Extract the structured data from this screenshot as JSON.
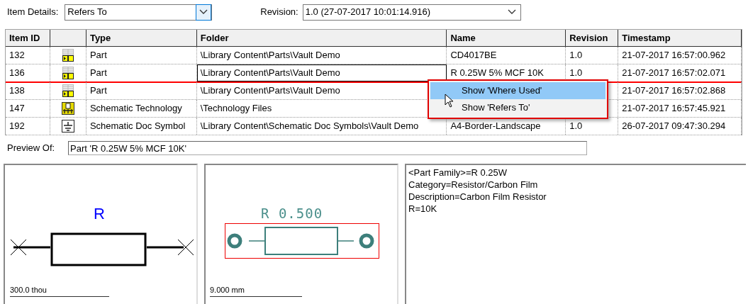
{
  "item_details": {
    "label": "Item Details:",
    "value": "Refers To"
  },
  "revision": {
    "label": "Revision:",
    "value": "1.0 (27-07-2017 10:01:14.916)"
  },
  "table": {
    "columns": [
      "Item ID",
      "Type",
      "Folder",
      "Name",
      "Revision",
      "Timestamp"
    ],
    "rows": [
      {
        "item_id": "132",
        "kind": "part",
        "type": "Part",
        "folder": "\\Library Content\\Parts\\Vault Demo",
        "name": "CD4017BE",
        "revision": "1.0",
        "timestamp": "21-07-2017 16:57:00.962",
        "focused": false
      },
      {
        "item_id": "136",
        "kind": "part",
        "type": "Part",
        "folder": "\\Library Content\\Parts\\Vault Demo",
        "name": "R 0.25W 5% MCF 10K",
        "revision": "1.0",
        "timestamp": "21-07-2017 16:57:02.071",
        "focused": true
      },
      {
        "item_id": "138",
        "kind": "part",
        "type": "Part",
        "folder": "\\Library Content\\Parts\\Vault Demo",
        "timestamp": "21-07-2017 16:57:02.868",
        "focused": false
      },
      {
        "item_id": "147",
        "kind": "technology",
        "type": "Schematic Technology",
        "folder": "\\Technology Files",
        "timestamp": "21-07-2017 16:57:45.921",
        "focused": false
      },
      {
        "item_id": "192",
        "kind": "symbol",
        "type": "Schematic Doc Symbol",
        "folder": "\\Library Content\\Schematic Doc Symbols\\Vault Demo",
        "name": "A4-Border-Landscape",
        "revision": "1.0",
        "timestamp": "26-07-2017 09:47:30.294",
        "focused": false
      }
    ]
  },
  "context_menu": {
    "items": [
      {
        "label": "Show 'Where Used'",
        "selected": true
      },
      {
        "label": "Show 'Refers To'",
        "selected": false
      }
    ]
  },
  "preview": {
    "label": "Preview Of:",
    "value": "Part 'R 0.25W 5% MCF 10K'"
  },
  "symbol_preview": {
    "designator": "R",
    "scale": "300.0 thou"
  },
  "footprint_preview": {
    "designator": "R 0.500",
    "scale": "9.000 mm"
  },
  "parameters": [
    "<Part Family>=R 0.25W",
    "Category=Resistor/Carbon Film",
    "Description=Carbon Film Resistor",
    "R=10K"
  ]
}
